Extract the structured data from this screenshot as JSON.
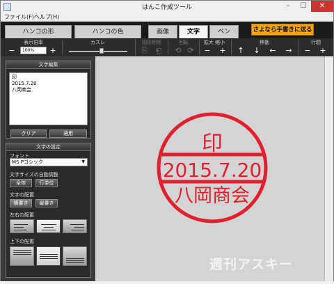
{
  "window": {
    "title": "はんこ作成ツール",
    "minimize": "–",
    "maximize": "☐",
    "close": "✕"
  },
  "menu": {
    "file": "ファイル(F)",
    "help": "ヘルプ(H)"
  },
  "tabs": [
    {
      "label": "ハンコの形",
      "active": false
    },
    {
      "label": "ハンコの色",
      "active": false
    },
    {
      "label": "画像",
      "active": false
    },
    {
      "label": "文字",
      "active": true
    },
    {
      "label": "ペン",
      "active": false
    }
  ],
  "send_button": "さよなら手書きに送る",
  "toolbar": {
    "zoom_label": "表示倍率",
    "zoom_value": "100%",
    "kasure_label": "カスレ",
    "delete_label": "図形削除",
    "rotate_label": "回転",
    "scale_label": "拡大 縮小",
    "move_label": "移動",
    "line_spacing_label": "行間",
    "minus": "−",
    "plus": "+",
    "up": "↑",
    "down": "↓",
    "left": "←",
    "right": "→"
  },
  "text_edit": {
    "header": "文字編集",
    "lines": [
      "印",
      "2015.7.20",
      "八岡商会"
    ],
    "clear": "クリア",
    "apply": "適用"
  },
  "text_settings": {
    "header": "文字の設定",
    "font_label": "フォント",
    "font_value": "MS Pゴシック",
    "autosize_label": "文字サイズの自動調整",
    "all": "全体",
    "per_line": "行単位",
    "arrange_label": "文字の配置",
    "horizontal": "横書き",
    "vertical": "縦書き",
    "lr_label": "左右の配置",
    "tb_label": "上下の配置"
  },
  "stamp": {
    "color": "#e0202c",
    "top": "印",
    "middle": "2015.7.20",
    "bottom": "八岡商会"
  },
  "watermark": "週刊アスキー"
}
